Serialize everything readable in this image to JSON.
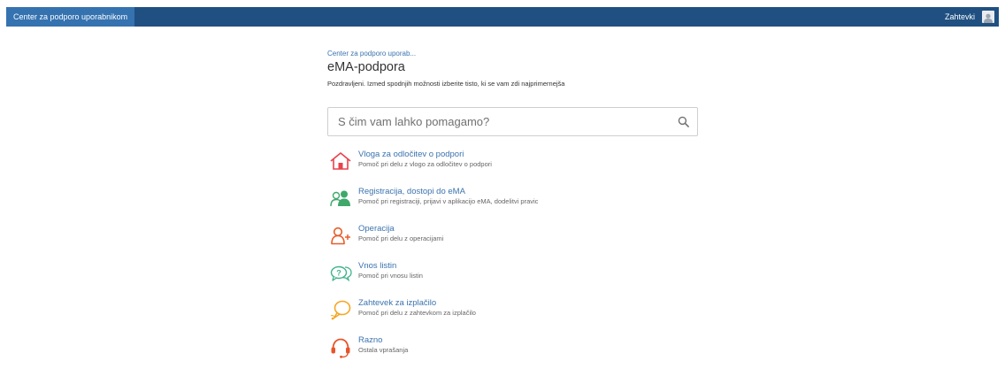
{
  "topbar": {
    "home_label": "Center za podporo uporabnikom",
    "requests_label": "Zahtevki"
  },
  "breadcrumb": "Center za podporo uporab...",
  "title": "eMA-podpora",
  "subtitle": "Pozdravljeni. Izmed spodnjih možnosti izberite tisto, ki se vam zdi najprimernejša",
  "search": {
    "placeholder": "S čim vam lahko pomagamo?"
  },
  "items": [
    {
      "label": "Vloga za odločitev o podpori",
      "desc": "Pomoč pri delu z vlogo za odločitev o podpori",
      "icon": "house-icon",
      "color": "#e8424d"
    },
    {
      "label": "Registracija, dostopi do eMA",
      "desc": "Pomoč pri registraciji, prijavi v aplikacijo eMA, dodelitvi pravic",
      "icon": "users-icon",
      "color": "#3fa86b"
    },
    {
      "label": "Operacija",
      "desc": "Pomoč pri delu z operacijami",
      "icon": "add-user-icon",
      "color": "#e85d2a"
    },
    {
      "label": "Vnos listin",
      "desc": "Pomoč pri vnosu listin",
      "icon": "question-bubble-icon",
      "color": "#3fb28c"
    },
    {
      "label": "Zahtevek za izplačilo",
      "desc": "Pomoč pri delu z zahtevkom za izplačilo",
      "icon": "chat-bubble-icon",
      "color": "#f4a623"
    },
    {
      "label": "Razno",
      "desc": "Ostala vprašanja",
      "icon": "headset-icon",
      "color": "#e8542a"
    }
  ]
}
